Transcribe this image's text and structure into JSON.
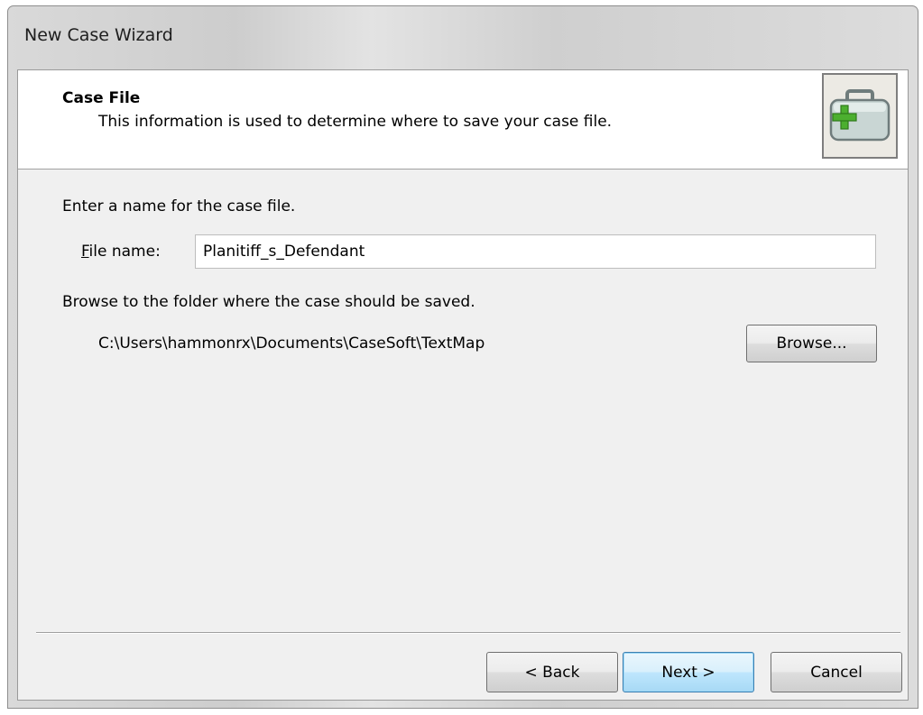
{
  "window": {
    "title": "New Case Wizard"
  },
  "header": {
    "title": "Case File",
    "subtitle": "This information is used to determine where to save your case file.",
    "icon": "medical-case-icon"
  },
  "body": {
    "name_prompt": "Enter a name for the case file.",
    "file_name_label_accel": "F",
    "file_name_label_rest": "ile name:",
    "file_name_value": "Planitiff_s_Defendant",
    "folder_prompt": "Browse to the folder where the case should be saved.",
    "folder_path": "C:\\Users\\hammonrx\\Documents\\CaseSoft\\TextMap",
    "browse_label": "Browse..."
  },
  "footer": {
    "back_label": "< Back",
    "next_label": "Next >",
    "cancel_label": "Cancel"
  },
  "colors": {
    "accent_border": "#3c7fb1",
    "icon_plus": "#4caf2f"
  }
}
